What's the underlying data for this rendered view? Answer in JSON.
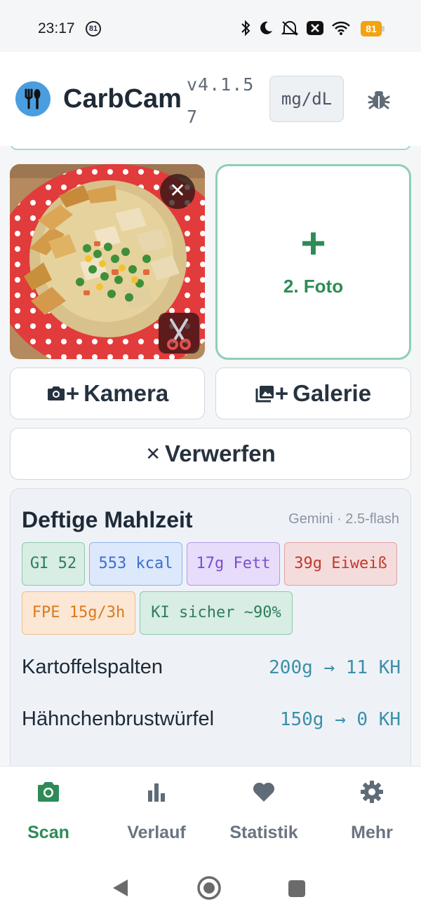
{
  "status_bar": {
    "time": "23:17",
    "notif_badge": "81",
    "battery": "81"
  },
  "header": {
    "app_name": "CarbCam",
    "version": "v4.1.57",
    "unit_toggle": "mg/dL",
    "icons": {
      "logo": "fork-spoon-icon",
      "debug": "bug-icon"
    }
  },
  "photos": {
    "remove_symbol": "✕",
    "add_symbol": "+",
    "add_label": "2. Foto"
  },
  "actions": {
    "camera_plus": "+",
    "camera_label": "Kamera",
    "gallery_plus": "+",
    "gallery_label": "Galerie",
    "discard_symbol": "✕",
    "discard_label": "Verwerfen"
  },
  "result": {
    "title": "Deftige Mahlzeit",
    "model": "Gemini · 2.5-flash",
    "chips": {
      "gi": "GI 52",
      "kcal": "553 kcal",
      "fett": "17g Fett",
      "eiweiss": "39g Eiweiß",
      "fpe": "FPE 15g/3h",
      "ki": "KI sicher ~90%"
    },
    "items": [
      {
        "name": "Kartoffelspalten",
        "amount": "200g → 11 KH"
      },
      {
        "name": "Hähnchenbrustwürfel",
        "amount": "150g → 0 KH"
      }
    ]
  },
  "nav": {
    "items": [
      {
        "label": "Scan",
        "icon": "camera-icon"
      },
      {
        "label": "Verlauf",
        "icon": "bar-chart-icon"
      },
      {
        "label": "Statistik",
        "icon": "heart-icon"
      },
      {
        "label": "Mehr",
        "icon": "gear-icon"
      }
    ]
  },
  "colors": {
    "accent": "#2e8b57",
    "logo_bg": "#4a9ee0",
    "plate_red": "#e23b3b"
  }
}
